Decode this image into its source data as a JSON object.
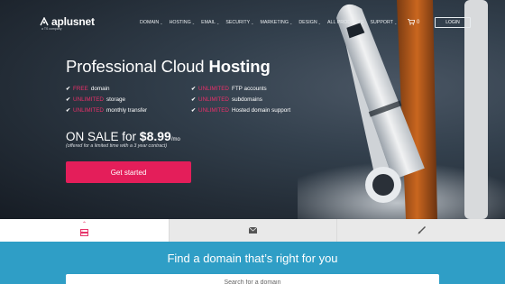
{
  "brand": {
    "name": "aplusnet",
    "sub": "a TS company"
  },
  "nav": {
    "items": [
      {
        "label": "DOMAIN"
      },
      {
        "label": "HOSTING"
      },
      {
        "label": "EMAIL"
      },
      {
        "label": "SECURITY"
      },
      {
        "label": "MARKETING"
      },
      {
        "label": "DESIGN"
      },
      {
        "label": "ALL PRODUCTS"
      },
      {
        "label": "SUPPORT"
      }
    ],
    "cart_count": "0",
    "login_label": "LOGIN"
  },
  "hero": {
    "title_light": "Professional Cloud ",
    "title_bold": "Hosting",
    "features": [
      {
        "highlight": "FREE",
        "text": " domain"
      },
      {
        "highlight": "UNLIMITED",
        "text": " FTP accounts"
      },
      {
        "highlight": "UNLIMITED",
        "text": " storage"
      },
      {
        "highlight": "UNLIMITED",
        "text": " subdomains"
      },
      {
        "highlight": "UNLIMITED",
        "text": " monthly transfer"
      },
      {
        "highlight": "UNLIMITED",
        "text": " Hosted domain support"
      }
    ],
    "sale_prefix": "ON SALE for ",
    "price": "$8.99",
    "per": "/mo",
    "note": "(offered for a limited time with a 3 year contract)",
    "cta_label": "Get started"
  },
  "domain_search": {
    "title": "Find a domain that’s right for you",
    "placeholder": "Search for a domain"
  },
  "colors": {
    "accent": "#e41e5a",
    "domain_bg": "#2f9ec6"
  },
  "icons": {
    "tab1": "server-icon",
    "tab2": "envelope-icon",
    "tab3": "paintbrush-icon"
  }
}
